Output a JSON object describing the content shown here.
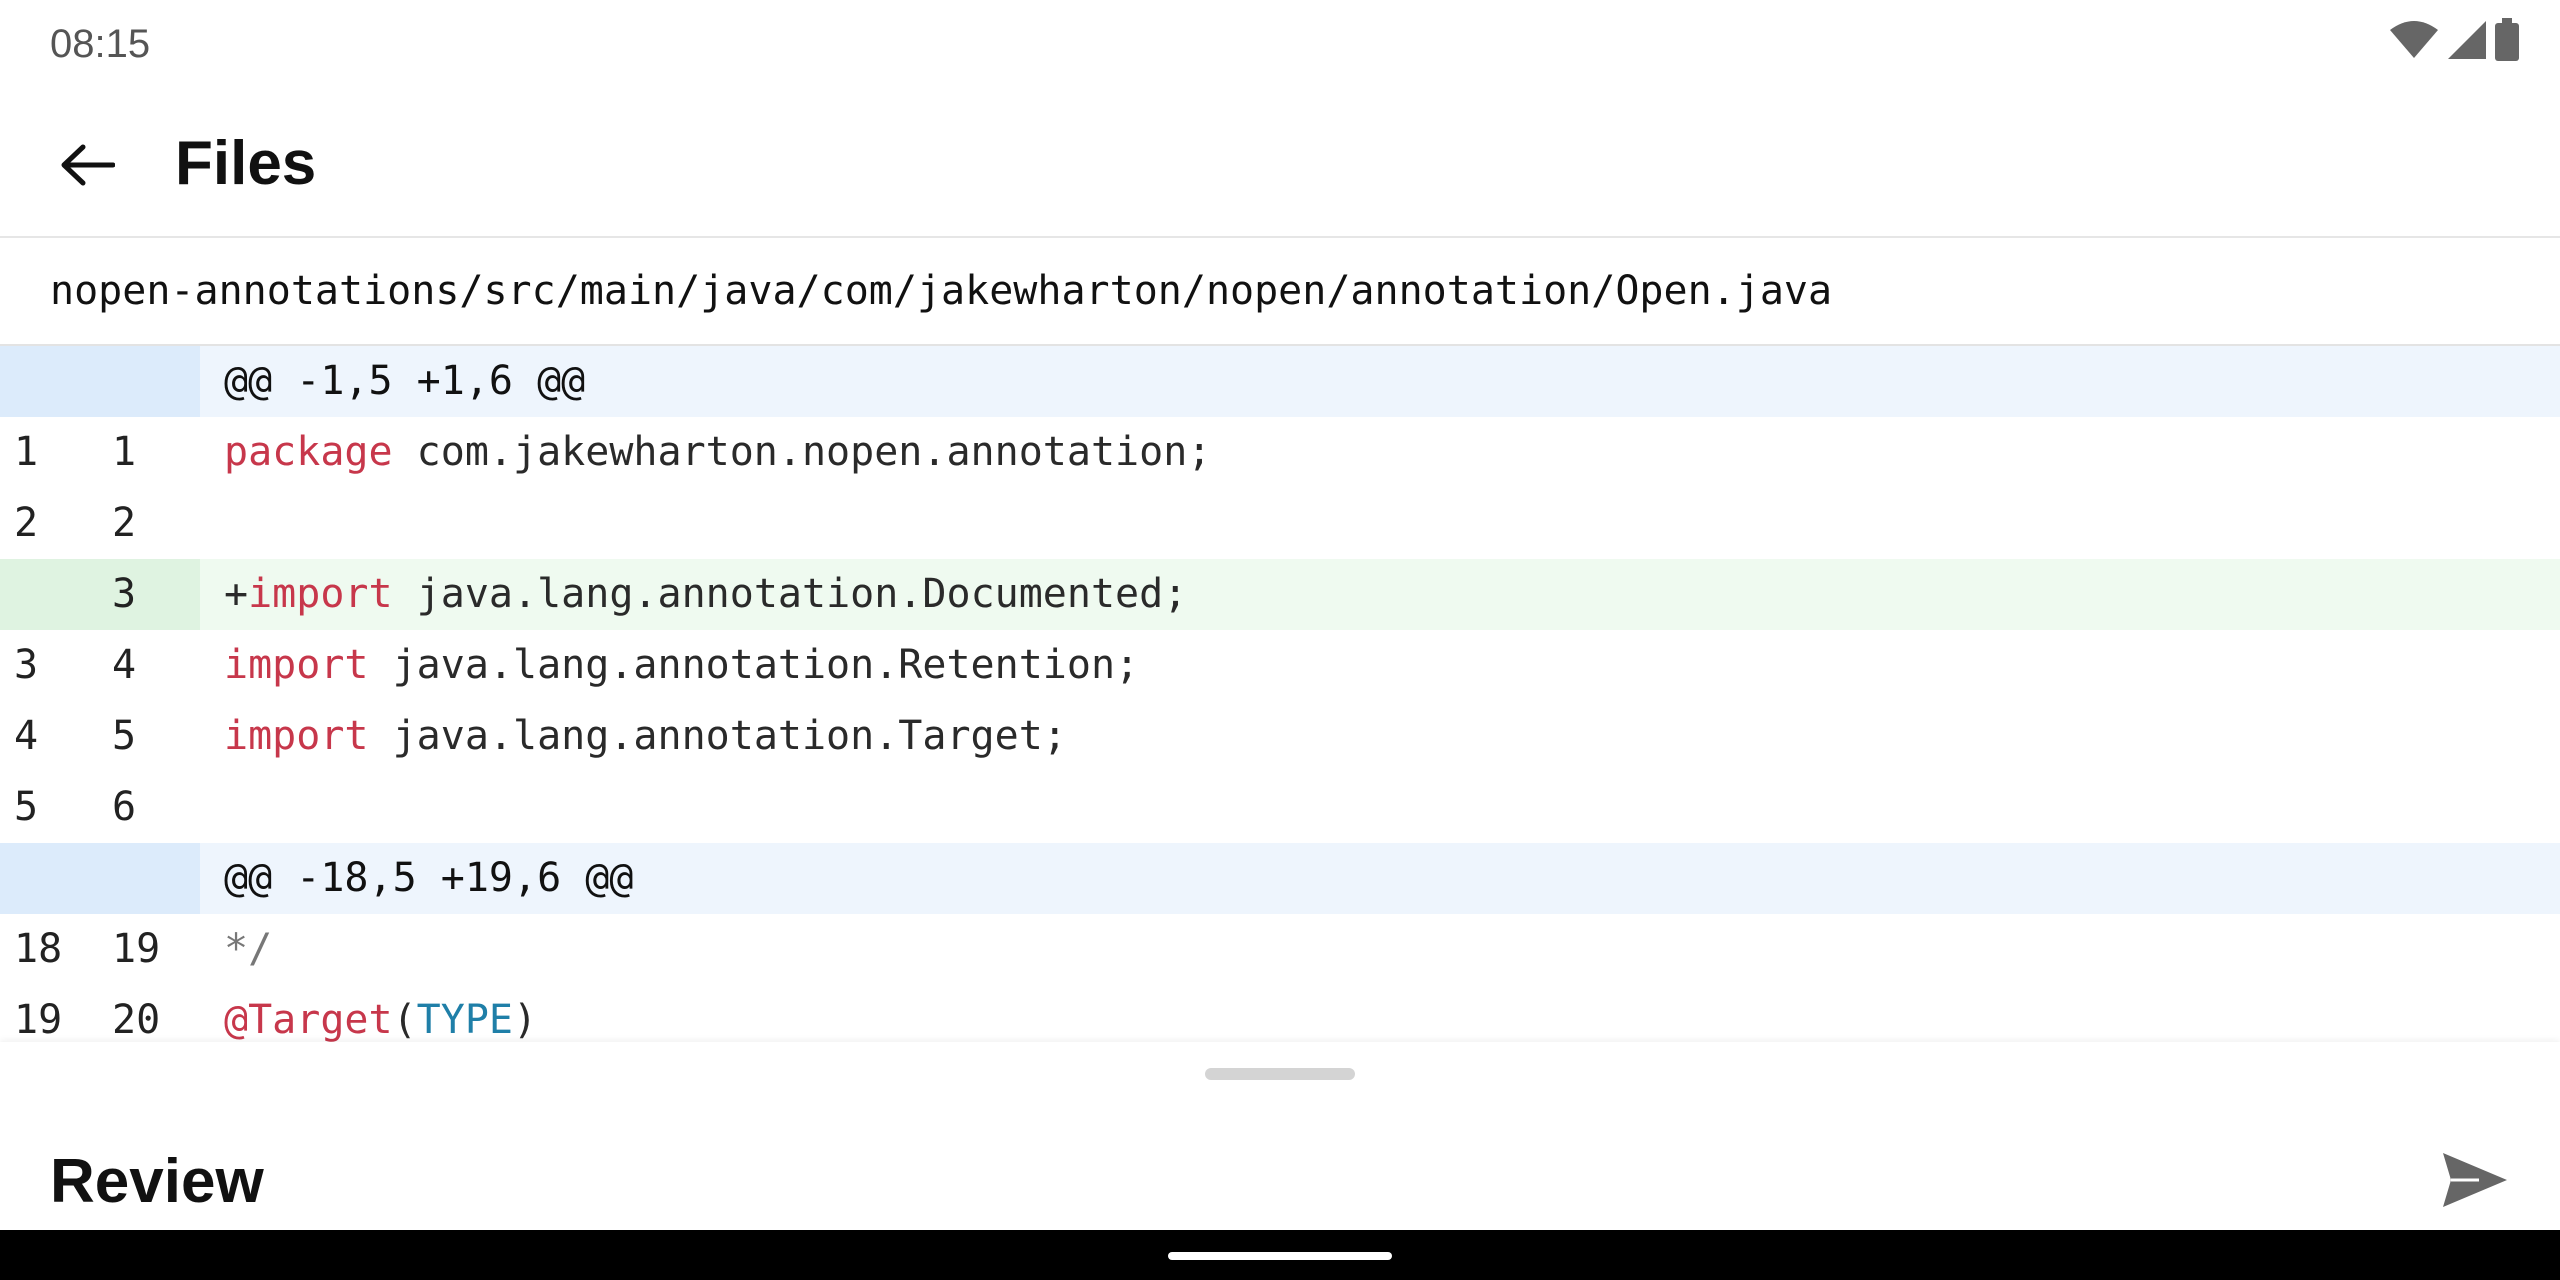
{
  "status_bar": {
    "time": "08:15",
    "icons": [
      "wifi-icon",
      "signal-icon",
      "battery-icon"
    ]
  },
  "app_bar": {
    "back_icon": "arrow-left-icon",
    "title": "Files"
  },
  "file_path": "nopen-annotations/src/main/java/com/jakewharton/nopen/annotation/Open.java",
  "diff": {
    "hunk1": {
      "header": "@@ -1,5 +1,6 @@",
      "lines": [
        {
          "old": "1",
          "new": "1",
          "kw": "package",
          "rest": " com.jakewharton.nopen.annotation;"
        },
        {
          "old": "2",
          "new": "2",
          "kw": "",
          "rest": ""
        },
        {
          "old": "",
          "new": "3",
          "prefix": "+",
          "kw": "import",
          "rest": " java.lang.annotation.Documented;"
        },
        {
          "old": "3",
          "new": "4",
          "kw": "import",
          "rest": " java.lang.annotation.Retention;"
        },
        {
          "old": "4",
          "new": "5",
          "kw": "import",
          "rest": " java.lang.annotation.Target;"
        },
        {
          "old": "5",
          "new": "6",
          "kw": "",
          "rest": ""
        }
      ]
    },
    "hunk2": {
      "header": "@@ -18,5 +19,6 @@",
      "lines": [
        {
          "old": "18",
          "new": "19",
          "comment": "*/"
        },
        {
          "old": "19",
          "new": "20",
          "annotation": "@Target",
          "open": "(",
          "type": "TYPE",
          "close": ")"
        }
      ]
    }
  },
  "sheet": {
    "title": "Review",
    "send_icon": "send-icon"
  },
  "colors": {
    "keyword": "#c7374b",
    "type": "#1f7fa8",
    "hunk_bg": "#eef5fd",
    "added_bg": "#effaf0"
  }
}
